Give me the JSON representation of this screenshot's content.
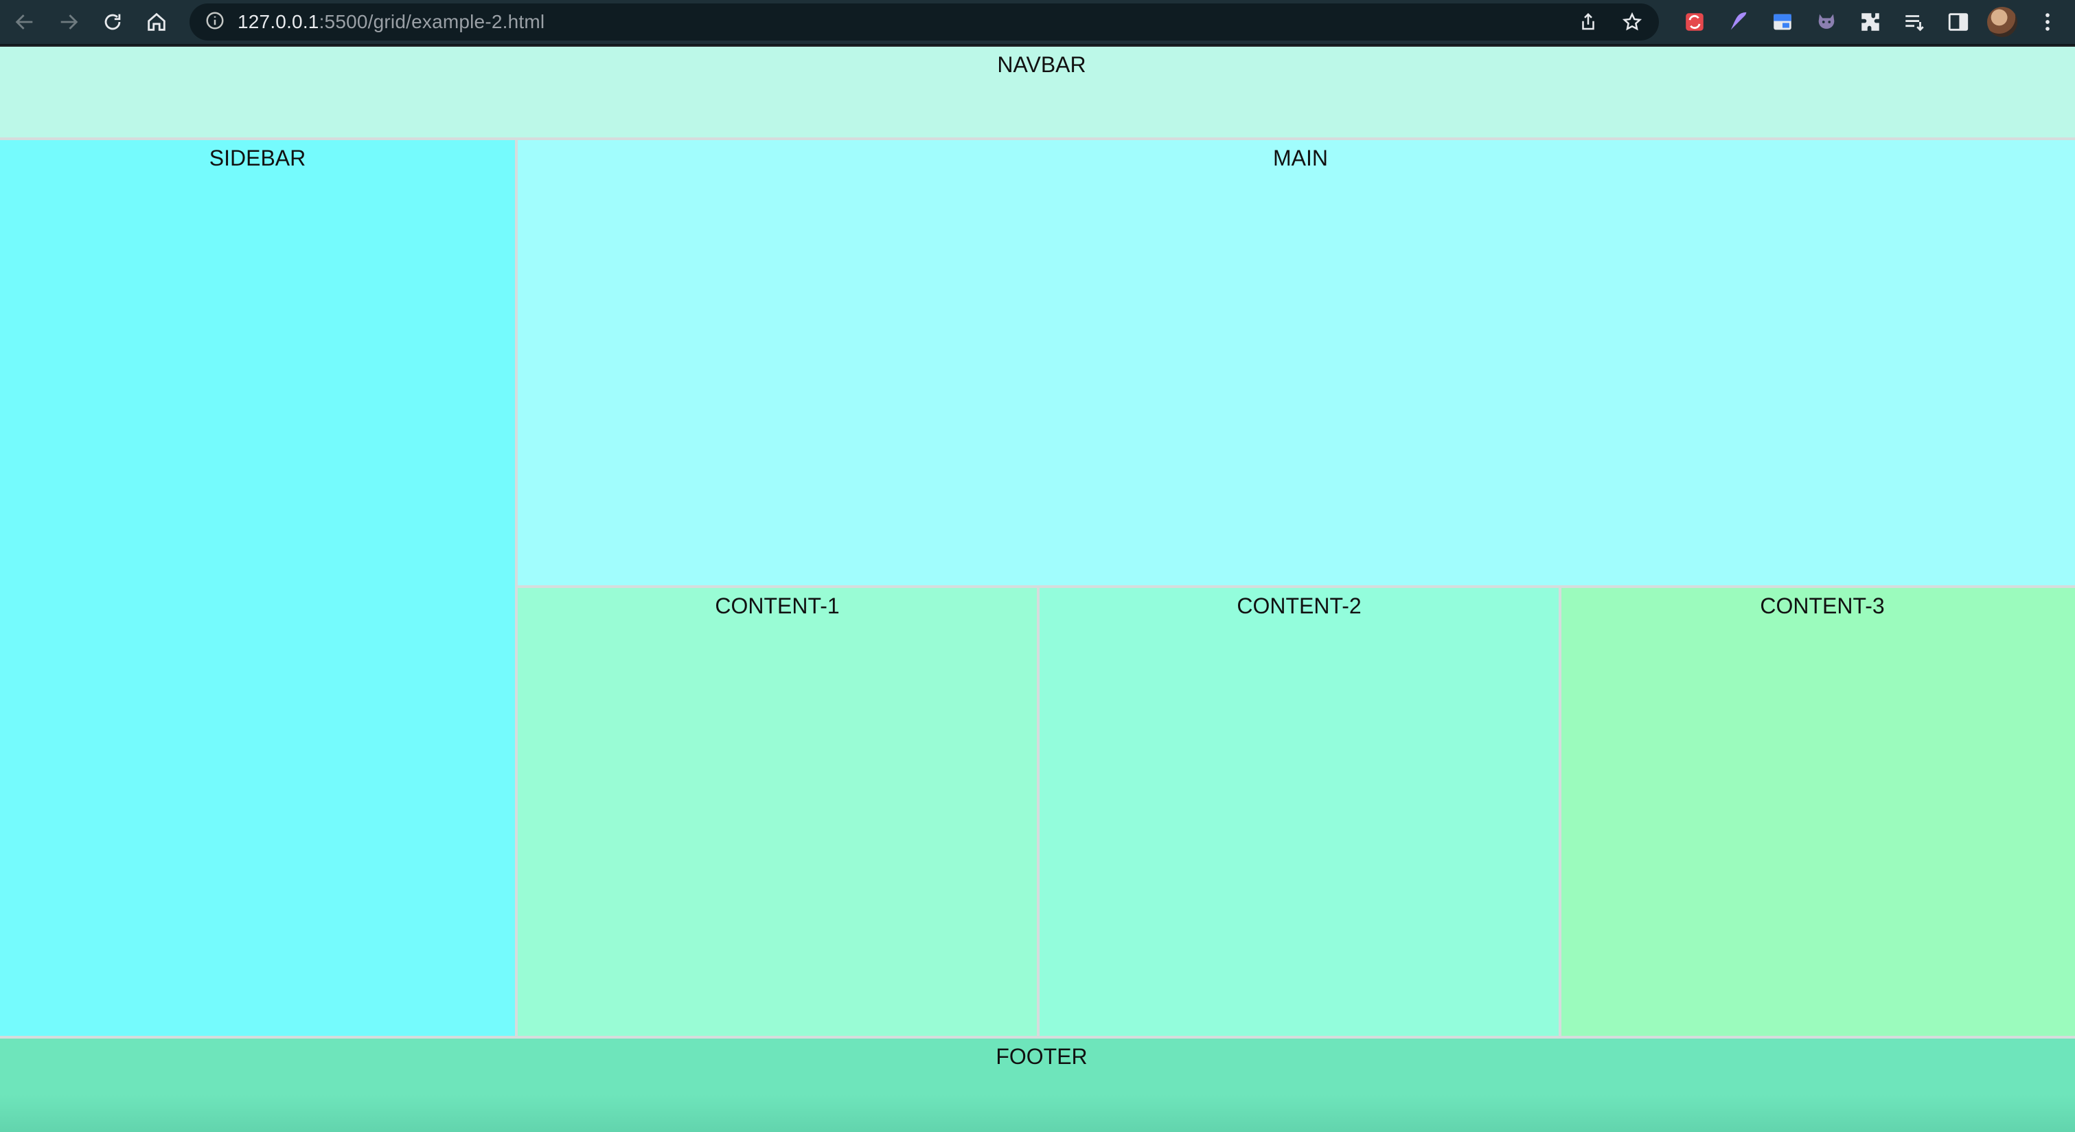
{
  "browser": {
    "url_host": "127.0.0.1",
    "url_path": ":5500/grid/example-2.html",
    "icons": {
      "back": "arrow-left-icon",
      "forward": "arrow-right-icon",
      "reload": "reload-icon",
      "home": "home-icon",
      "info": "info-icon",
      "share": "share-icon",
      "bookmark": "star-icon",
      "extensions": [
        "sync-extension-icon",
        "feather-extension-icon",
        "window-extension-icon",
        "octocat-extension-icon",
        "puzzle-icon",
        "reading-list-icon",
        "side-panel-icon"
      ],
      "menu": "kebab-menu-icon"
    }
  },
  "grid": {
    "navbar": "NAVBAR",
    "sidebar": "SIDEBAR",
    "main": "MAIN",
    "content1": "CONTENT-1",
    "content2": "CONTENT-2",
    "content3": "CONTENT-3",
    "footer": "FOOTER"
  },
  "colors": {
    "navbar": "#bcf8e8",
    "sidebar": "#75fbfd",
    "main": "#a1fdfd",
    "content1": "#99fcd5",
    "content2": "#93fddc",
    "content3": "#9bfbbd",
    "footer": "#6ee5bb",
    "chrome": "#1e3038"
  }
}
